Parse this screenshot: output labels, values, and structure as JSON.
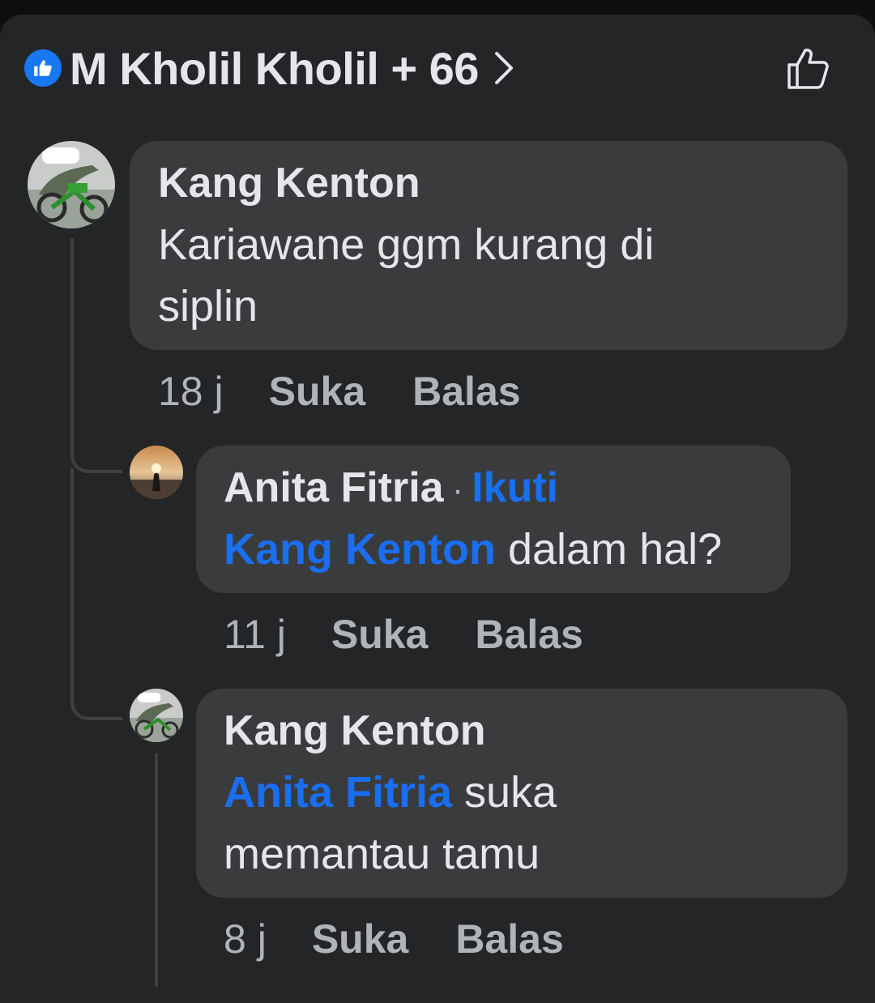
{
  "header": {
    "reactors_text": "M Kholil Kholil + 66",
    "icons": [
      "like-reaction-icon",
      "chevron-right-icon",
      "thumbs-up-outline-icon"
    ],
    "accent": "#1877f2"
  },
  "comments": [
    {
      "author": "Kang Kenton",
      "text": "Kariawane ggm kurang di siplin",
      "time": "18 j",
      "like": "Suka",
      "reply": "Balas"
    },
    {
      "author": "Anita Fitria",
      "separator": "·",
      "follow": "Ikuti",
      "mention": "Kang Kenton",
      "text": " dalam hal?",
      "time": "11 j",
      "like": "Suka",
      "reply": "Balas"
    },
    {
      "author": "Kang Kenton",
      "mention": "Anita Fitria",
      "text": " suka memantau tamu",
      "time": "8 j",
      "like": "Suka",
      "reply": "Balas"
    }
  ],
  "colors": {
    "background": "#242526",
    "bubble": "#3a3b3c",
    "mention": "#1a6ef0",
    "muted_text": "#b0b3b8"
  }
}
